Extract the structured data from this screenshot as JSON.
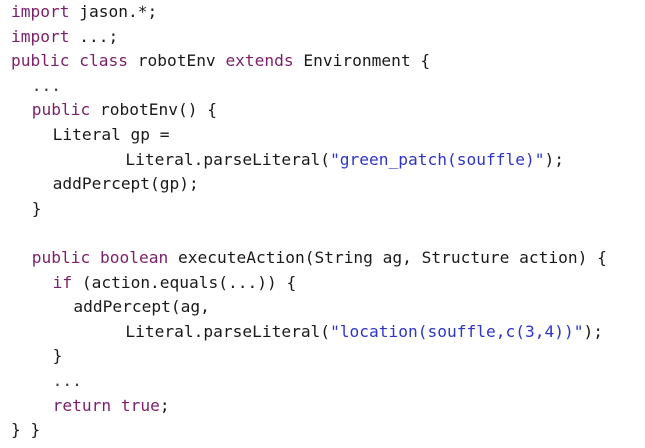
{
  "lines": [
    {
      "indent": 0,
      "tokens": [
        {
          "t": "import",
          "k": "kw"
        },
        {
          "t": " jason.*;"
        }
      ]
    },
    {
      "indent": 0,
      "tokens": [
        {
          "t": "import",
          "k": "kw"
        },
        {
          "t": " ...;"
        }
      ]
    },
    {
      "indent": 0,
      "tokens": [
        {
          "t": "public",
          "k": "kw"
        },
        {
          "t": " "
        },
        {
          "t": "class",
          "k": "kw"
        },
        {
          "t": " robotEnv "
        },
        {
          "t": "extends",
          "k": "kw"
        },
        {
          "t": " Environment {"
        }
      ]
    },
    {
      "indent": 1,
      "tokens": [
        {
          "t": "...",
          "k": "dots"
        }
      ]
    },
    {
      "indent": 1,
      "tokens": [
        {
          "t": "public",
          "k": "kw"
        },
        {
          "t": " robotEnv() {"
        }
      ]
    },
    {
      "indent": 2,
      "tokens": [
        {
          "t": "Literal gp ="
        }
      ]
    },
    {
      "indent": 5.5,
      "tokens": [
        {
          "t": "Literal.parseLiteral("
        },
        {
          "t": "\"green_patch(souffle)\"",
          "k": "str"
        },
        {
          "t": ");"
        }
      ]
    },
    {
      "indent": 2,
      "tokens": [
        {
          "t": "addPercept(gp);"
        }
      ]
    },
    {
      "indent": 1,
      "tokens": [
        {
          "t": "}"
        }
      ]
    },
    {
      "indent": 0,
      "tokens": []
    },
    {
      "indent": 1,
      "tokens": [
        {
          "t": "public",
          "k": "kw"
        },
        {
          "t": " "
        },
        {
          "t": "boolean",
          "k": "kw"
        },
        {
          "t": " executeAction(String ag, Structure action) {"
        }
      ]
    },
    {
      "indent": 2,
      "tokens": [
        {
          "t": "if",
          "k": "kw"
        },
        {
          "t": " (action.equals(...)) {"
        }
      ]
    },
    {
      "indent": 3,
      "tokens": [
        {
          "t": "addPercept(ag,"
        }
      ]
    },
    {
      "indent": 5.5,
      "tokens": [
        {
          "t": "Literal.parseLiteral("
        },
        {
          "t": "\"location(souffle,c(3,4))\"",
          "k": "str"
        },
        {
          "t": ");"
        }
      ]
    },
    {
      "indent": 2,
      "tokens": [
        {
          "t": "}"
        }
      ]
    },
    {
      "indent": 2,
      "tokens": [
        {
          "t": "...",
          "k": "dots"
        }
      ]
    },
    {
      "indent": 2,
      "tokens": [
        {
          "t": "return",
          "k": "kw"
        },
        {
          "t": " "
        },
        {
          "t": "true",
          "k": "kw"
        },
        {
          "t": ";"
        }
      ]
    },
    {
      "indent": 0,
      "tokens": [
        {
          "t": "} }"
        }
      ]
    }
  ]
}
